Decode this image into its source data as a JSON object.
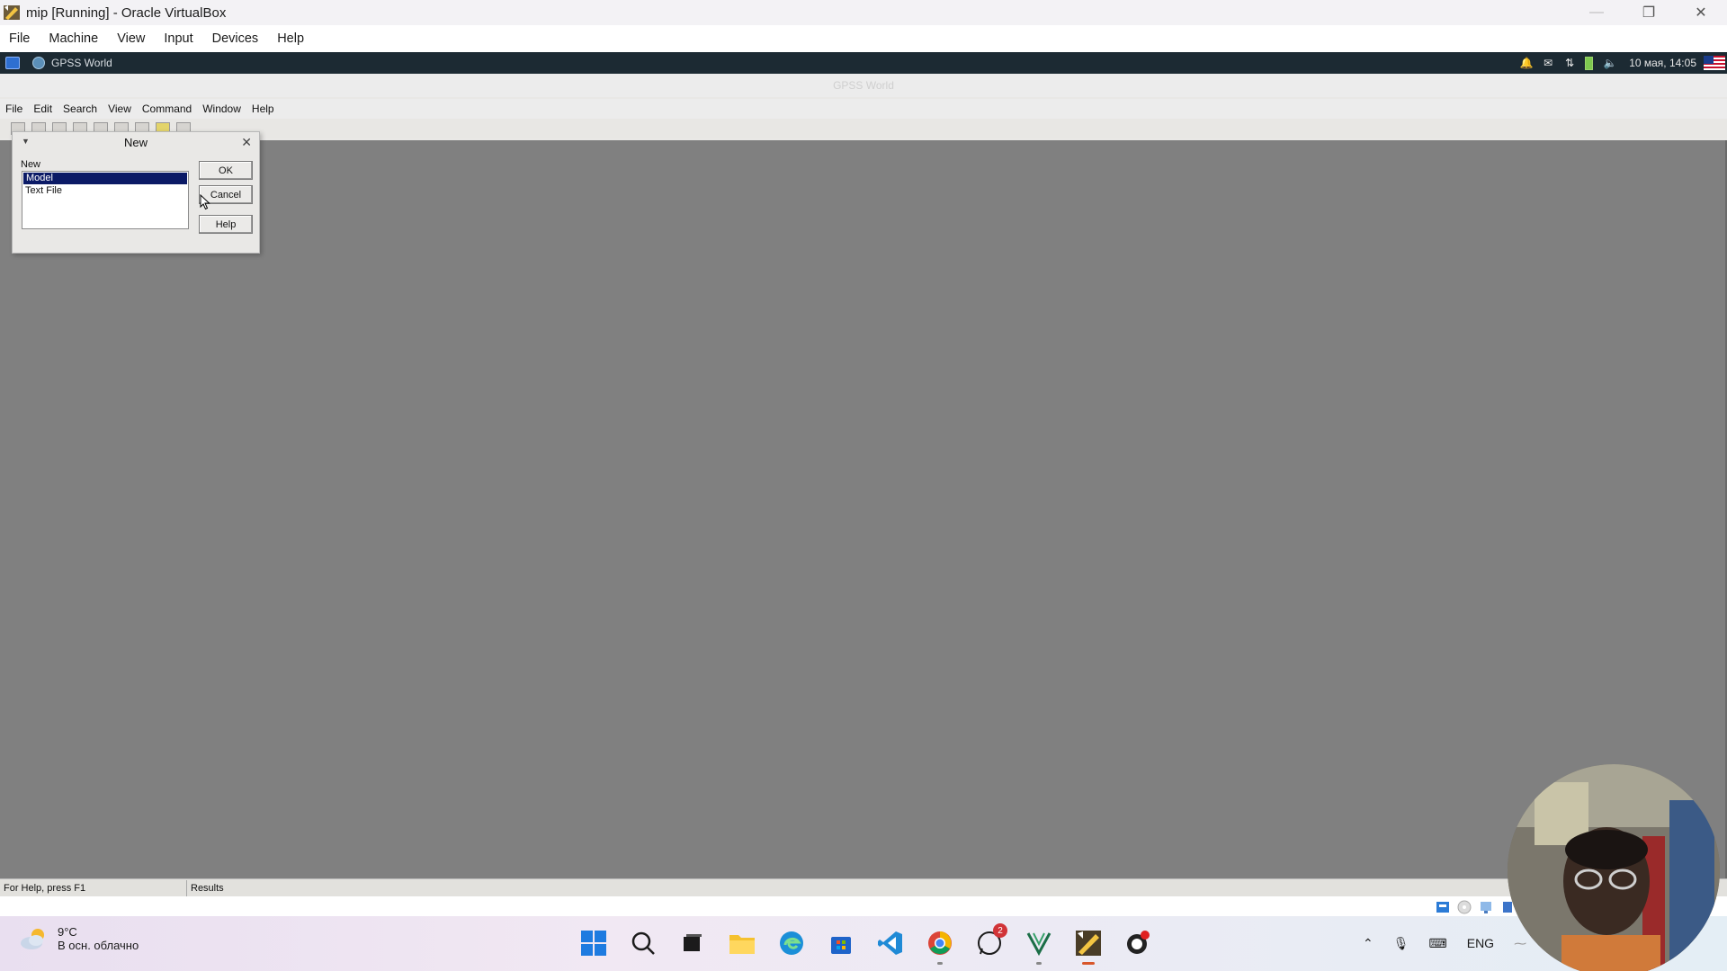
{
  "host_window": {
    "title": "mip [Running] - Oracle VirtualBox",
    "controls": {
      "minimize": "—",
      "restore": "❐",
      "close": "✕"
    }
  },
  "host_menu": [
    "File",
    "Machine",
    "View",
    "Input",
    "Devices",
    "Help"
  ],
  "guest_panel": {
    "task_label": "GPSS World",
    "clock": "10 мая, 14:05"
  },
  "gpss": {
    "caption": "GPSS World",
    "menu": [
      "File",
      "Edit",
      "Search",
      "View",
      "Command",
      "Window",
      "Help"
    ],
    "status": {
      "help": "For Help, press F1",
      "results": "Results"
    }
  },
  "new_dialog": {
    "title": "New",
    "label": "New",
    "items": [
      "Model",
      "Text File"
    ],
    "selected": "Model",
    "ok": "OK",
    "cancel": "Cancel",
    "help": "Help"
  },
  "taskbar": {
    "weather_temp": "9°C",
    "weather_desc": "В осн. облачно",
    "whatsapp_badge": "2",
    "language": "ENG"
  },
  "colors": {
    "mdi_background": "#808080",
    "selection": "#0b1a66",
    "guest_panel": "#1c2a33"
  }
}
